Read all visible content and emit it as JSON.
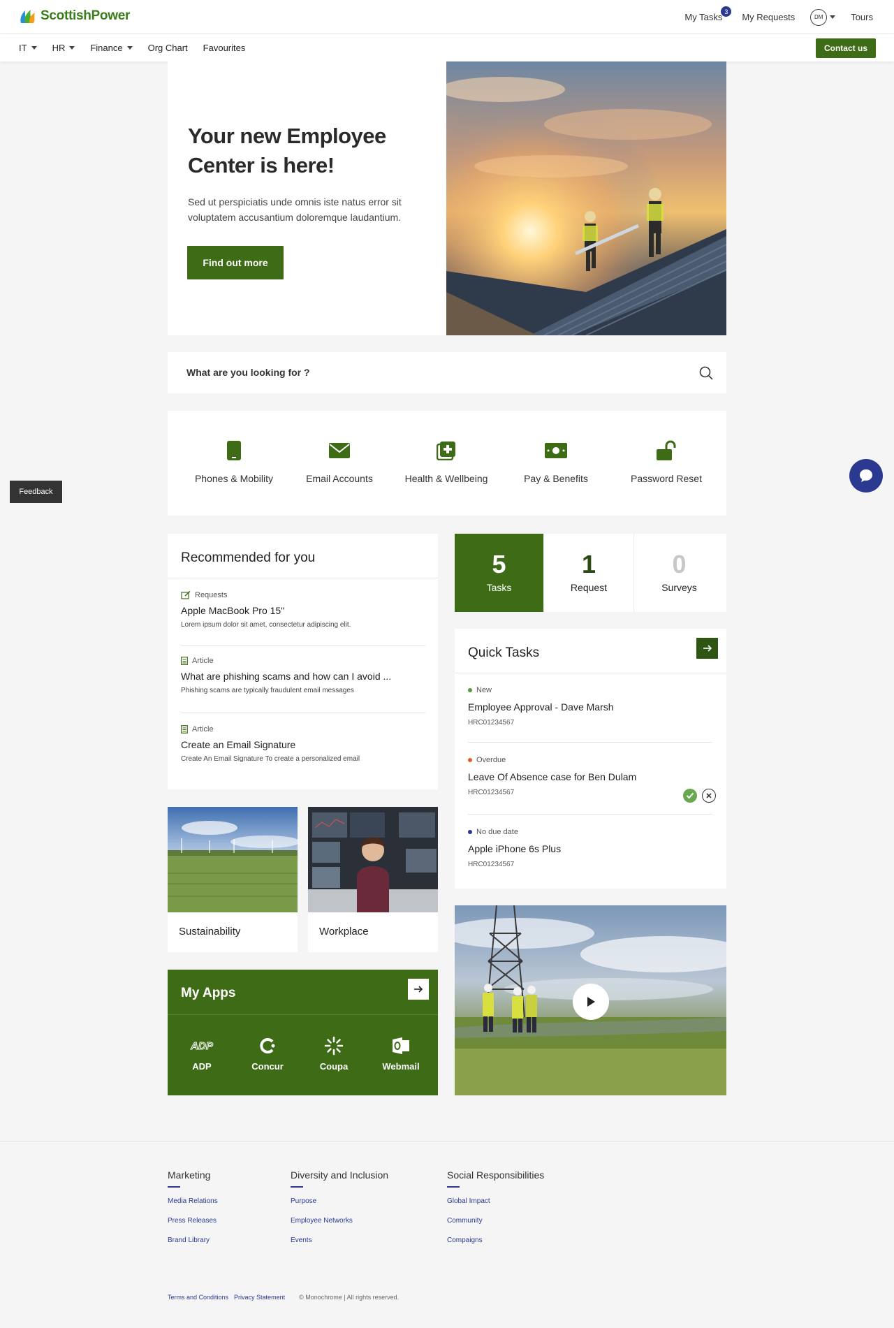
{
  "brand": {
    "name": "ScottishPower",
    "accent": "#3d6b16",
    "blue": "#2b3990"
  },
  "topbar": {
    "my_tasks": "My Tasks",
    "tasks_badge": "3",
    "my_requests": "My Requests",
    "avatar_initials": "DM",
    "tours": "Tours"
  },
  "nav": {
    "items": [
      {
        "label": "IT",
        "has_dropdown": true
      },
      {
        "label": "HR",
        "has_dropdown": true
      },
      {
        "label": "Finance",
        "has_dropdown": true
      },
      {
        "label": "Org Chart",
        "has_dropdown": false
      },
      {
        "label": "Favourites",
        "has_dropdown": false
      }
    ],
    "contact": "Contact us"
  },
  "hero": {
    "title": "Your new Employee Center is here!",
    "text": "Sed ut perspiciatis unde omnis iste natus error sit voluptatem accusantium doloremque laudantium.",
    "button": "Find out more"
  },
  "search": {
    "placeholder": "What are you looking for ?"
  },
  "categories": [
    {
      "label": "Phones & Mobility",
      "icon": "phone-icon"
    },
    {
      "label": "Email Accounts",
      "icon": "envelope-icon"
    },
    {
      "label": "Health & Wellbeing",
      "icon": "medical-icon"
    },
    {
      "label": "Pay & Benefits",
      "icon": "money-icon"
    },
    {
      "label": "Password Reset",
      "icon": "unlock-icon"
    }
  ],
  "feedback": "Feedback",
  "recommended": {
    "title": "Recommended for you",
    "items": [
      {
        "type": "Requests",
        "name": "Apple MacBook Pro 15\"",
        "desc": "Lorem ipsum dolor sit amet, consectetur adipiscing elit."
      },
      {
        "type": "Article",
        "name": "What are phishing scams and how can I avoid ...",
        "desc": "Phishing scams are typically fraudulent email messages"
      },
      {
        "type": "Article",
        "name": "Create an Email Signature",
        "desc": "Create An Email Signature To create a personalized email"
      }
    ]
  },
  "tiles": [
    {
      "label": "Sustainability"
    },
    {
      "label": "Workplace"
    }
  ],
  "my_apps": {
    "title": "My Apps",
    "apps": [
      {
        "label": "ADP"
      },
      {
        "label": "Concur"
      },
      {
        "label": "Coupa"
      },
      {
        "label": "Webmail"
      }
    ]
  },
  "stats": [
    {
      "num": "5",
      "label": "Tasks"
    },
    {
      "num": "1",
      "label": "Request"
    },
    {
      "num": "0",
      "label": "Surveys"
    }
  ],
  "quick_tasks": {
    "title": "Quick Tasks",
    "items": [
      {
        "status": "New",
        "status_color": "#5a9a3a",
        "name": "Employee Approval - Dave Marsh",
        "number": "HRC01234567"
      },
      {
        "status": "Overdue",
        "status_color": "#e8562a",
        "name": "Leave Of Absence case for Ben Dulam",
        "number": "HRC01234567"
      },
      {
        "status": "No due date",
        "status_color": "#2b3990",
        "name": "Apple iPhone 6s Plus",
        "number": "HRC01234567"
      }
    ]
  },
  "footer": {
    "columns": [
      {
        "heading": "Marketing",
        "links": [
          "Media Relations",
          "Press Releases",
          "Brand Library"
        ]
      },
      {
        "heading": "Diversity and Inclusion",
        "links": [
          "Purpose",
          "Employee Networks",
          "Events"
        ]
      },
      {
        "heading": "Social Responsibilities",
        "links": [
          "Global Impact",
          "Community",
          "Compaigns"
        ]
      }
    ],
    "terms": "Terms and Conditions",
    "privacy": "Privacy Statement",
    "copyright": "© Monochrome | All rights reserved."
  }
}
